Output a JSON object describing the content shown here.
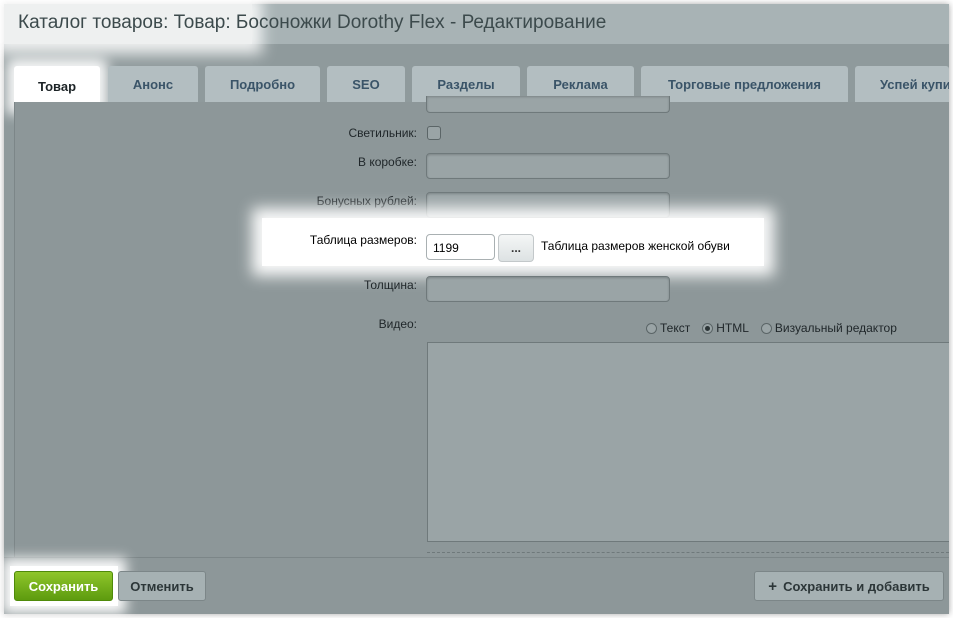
{
  "header": {
    "title_prefix": "Каталог товаров: Товар:",
    "title_rest": " Босоножки Dorothy Flex - Редактирование"
  },
  "tabs": [
    {
      "label": "Товар",
      "active": true
    },
    {
      "label": "Анонс"
    },
    {
      "label": "Подробно"
    },
    {
      "label": "SEO"
    },
    {
      "label": "Разделы"
    },
    {
      "label": "Реклама"
    },
    {
      "label": "Торговые предложения"
    },
    {
      "label": "Успей купить"
    }
  ],
  "form": {
    "lamp_label": "Светильник:",
    "box_label": "В коробке:",
    "bonus_label": "Бонусных рублей:",
    "size_table_label": "Таблица размеров:",
    "size_table_value": "1199",
    "size_table_button": "...",
    "size_table_desc": "Таблица размеров женской обуви",
    "thickness_label": "Толщина:",
    "video_label": "Видео:",
    "editor_modes": [
      "Текст",
      "HTML",
      "Визуальный редактор"
    ],
    "editor_mode_selected": "HTML"
  },
  "footer": {
    "save_label": "Сохранить",
    "cancel_label": "Отменить",
    "save_add_label": "Сохранить и добавить"
  }
}
